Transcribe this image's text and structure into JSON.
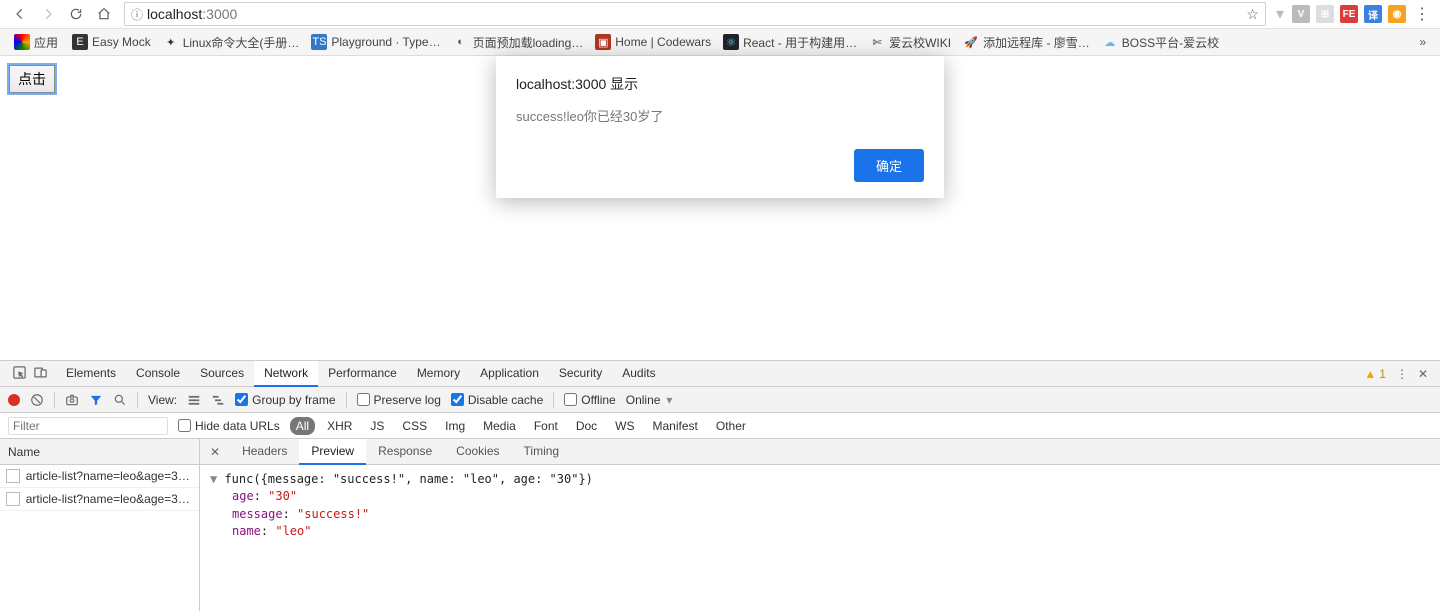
{
  "browser": {
    "url_host": "localhost",
    "url_port": ":3000",
    "bookmarks_label": "应用",
    "bookmarks": [
      {
        "label": "Easy Mock",
        "bg": "#333",
        "txt": "E",
        "fg": "#fff"
      },
      {
        "label": "Linux命令大全(手册…",
        "bg": "transparent",
        "txt": "✦",
        "fg": "#333"
      },
      {
        "label": "Playground · Type…",
        "bg": "#3178c6",
        "txt": "TS",
        "fg": "#fff"
      },
      {
        "label": "页面预加载loading…",
        "bg": "transparent",
        "txt": "◐",
        "fg": "#555"
      },
      {
        "label": "Home | Codewars",
        "bg": "#b1361e",
        "txt": "▣",
        "fg": "#fff"
      },
      {
        "label": "React - 用于构建用…",
        "bg": "#20232a",
        "txt": "⚛",
        "fg": "#61dafb"
      },
      {
        "label": "爱云校WIKI",
        "bg": "transparent",
        "txt": "✄",
        "fg": "#333"
      },
      {
        "label": "添加远程库 - 廖雪…",
        "bg": "transparent",
        "txt": "🚀",
        "fg": "#333"
      },
      {
        "label": "BOSS平台-爱云校",
        "bg": "transparent",
        "txt": "☁",
        "fg": "#6bb7e8"
      }
    ],
    "ext_icons": [
      {
        "bg": "#bbb",
        "txt": "V"
      },
      {
        "bg": "#ddd",
        "txt": "⊞"
      },
      {
        "bg": "#e03b3b",
        "txt": "FE"
      },
      {
        "bg": "#3b82e0",
        "txt": "译"
      },
      {
        "bg": "#f6a323",
        "txt": "◉"
      }
    ]
  },
  "page": {
    "button_label": "点击"
  },
  "alert": {
    "title": "localhost:3000 显示",
    "message": "success!leo你已经30岁了",
    "ok_label": "确定"
  },
  "devtools": {
    "tabs": [
      "Elements",
      "Console",
      "Sources",
      "Network",
      "Performance",
      "Memory",
      "Application",
      "Security",
      "Audits"
    ],
    "active_tab": "Network",
    "warnings": "1",
    "toolbar": {
      "view_label": "View:",
      "group_by_frame": "Group by frame",
      "preserve_log": "Preserve log",
      "disable_cache": "Disable cache",
      "offline": "Offline",
      "throttling": "Online"
    },
    "filter": {
      "placeholder": "Filter",
      "hide_data_urls": "Hide data URLs",
      "types": [
        "All",
        "XHR",
        "JS",
        "CSS",
        "Img",
        "Media",
        "Font",
        "Doc",
        "WS",
        "Manifest",
        "Other"
      ]
    },
    "name_header": "Name",
    "requests": [
      "article-list?name=leo&age=30…",
      "article-list?name=leo&age=30…"
    ],
    "detail_tabs": [
      "Headers",
      "Preview",
      "Response",
      "Cookies",
      "Timing"
    ],
    "detail_active": "Preview",
    "preview": {
      "top": "func({message: \"success!\", name: \"leo\", age: \"30\"})",
      "entries": [
        {
          "k": "age",
          "v": "\"30\""
        },
        {
          "k": "message",
          "v": "\"success!\""
        },
        {
          "k": "name",
          "v": "\"leo\""
        }
      ]
    }
  }
}
